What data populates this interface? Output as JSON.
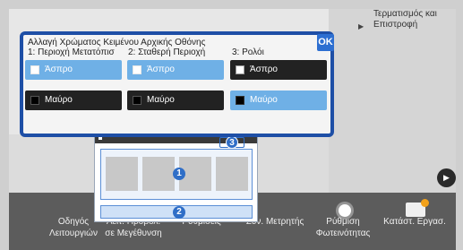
{
  "header": {
    "finish_label": "Τερματισμός και Επιστροφή"
  },
  "dialog": {
    "title": "Αλλαγή Χρώματος Κειμένου Αρχικής Οθόνης",
    "ok_label": "OK",
    "columns": [
      {
        "label": "1: Περιοχή Μετατόπισ",
        "white_label": "Άσπρο",
        "black_label": "Μαύρο",
        "selected": "white"
      },
      {
        "label": "2: Σταθερή Περιοχή",
        "white_label": "Άσπρο",
        "black_label": "Μαύρο",
        "selected": "white"
      },
      {
        "label": "3: Ρολόι",
        "white_label": "Άσπρο",
        "black_label": "Μαύρο",
        "selected": "black"
      }
    ]
  },
  "preview": {
    "badges": [
      "1",
      "2",
      "3"
    ]
  },
  "dock": {
    "items": [
      {
        "label": "Οδηγός Λειτουργιών",
        "icon": "none"
      },
      {
        "label": "Λειτ. Προβολ. σε Μεγέθυνση",
        "icon": "none"
      },
      {
        "label": "Ρυθμίσεις",
        "icon": "none"
      },
      {
        "label": "Συν. Μετρητής",
        "icon": "none"
      },
      {
        "label": "Ρύθμιση Φωτεινότητας",
        "icon": "brightness-icon"
      },
      {
        "label": "Κατάστ. Εργασ.",
        "icon": "job-status-icon"
      }
    ]
  },
  "colors": {
    "dialog_border": "#1e4fa6",
    "selected_option": "#6fb0e6",
    "ok_button": "#2d6fd1",
    "badge": "#2f6ec7"
  }
}
